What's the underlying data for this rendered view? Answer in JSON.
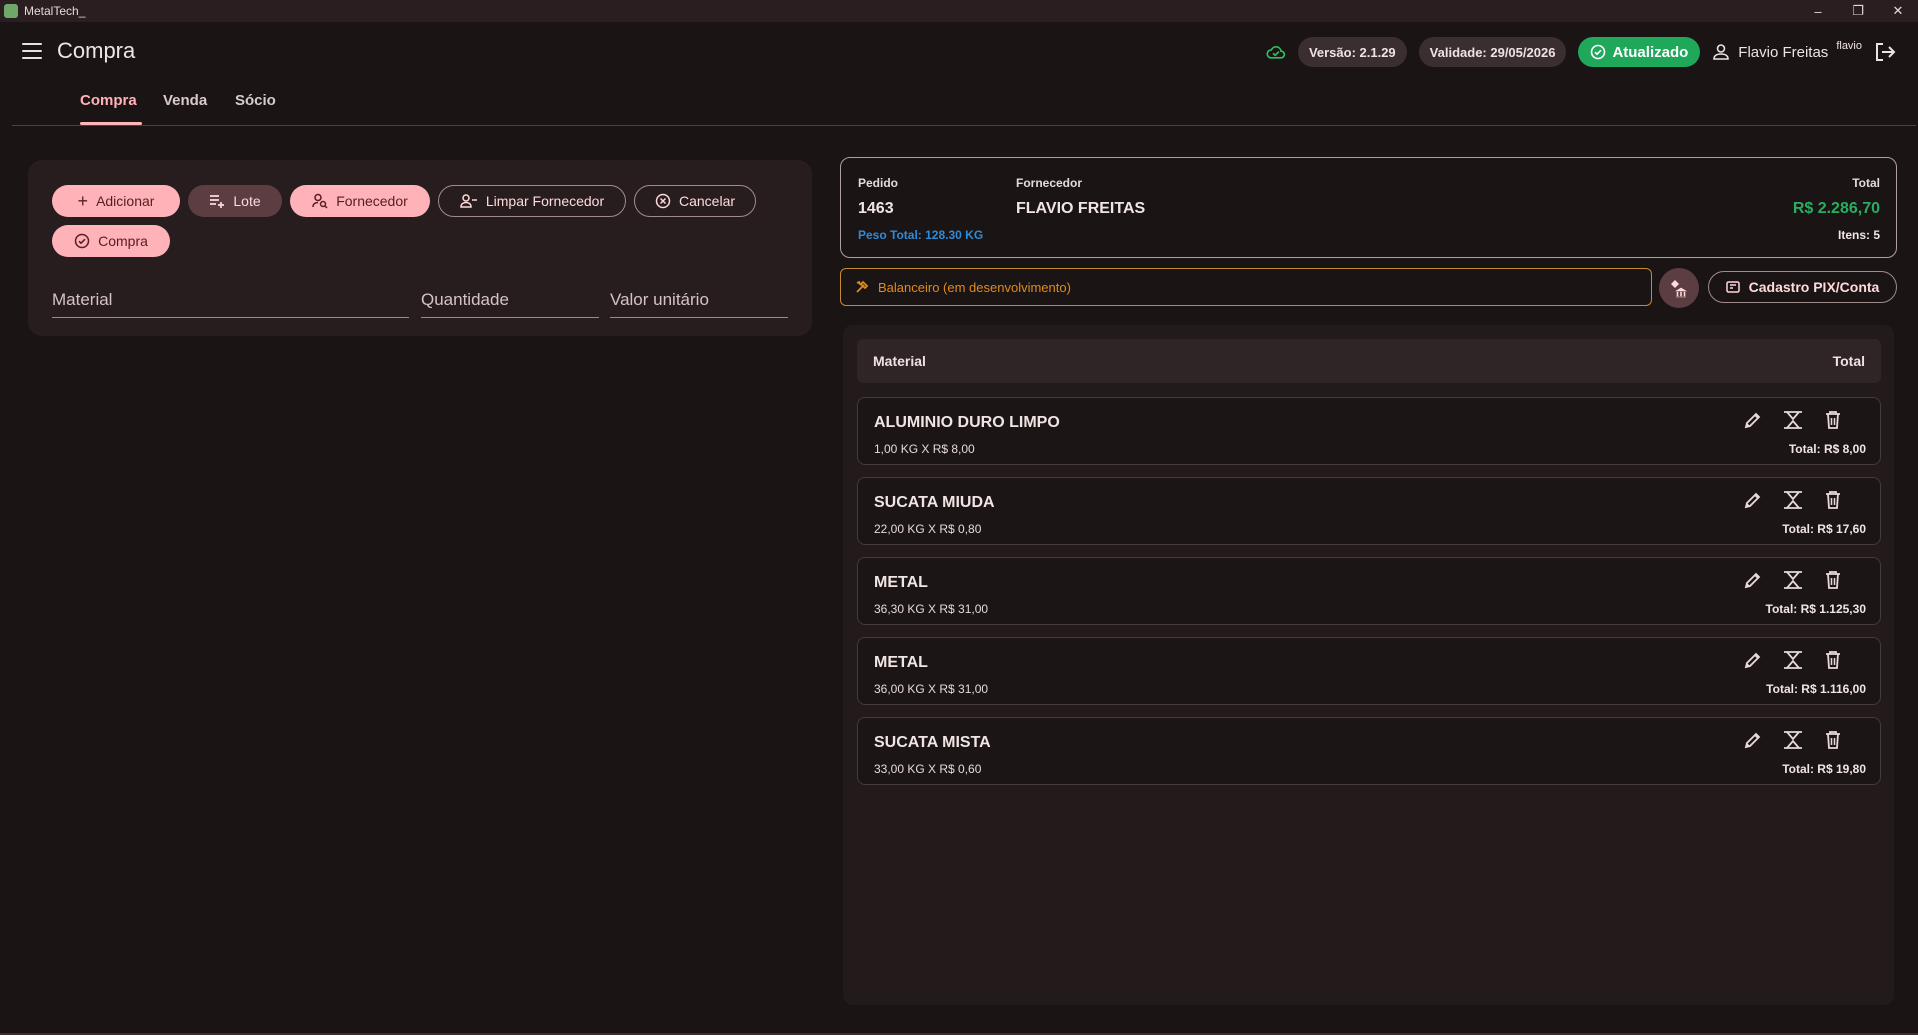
{
  "window": {
    "title": "MetalTech_",
    "controls": [
      "–",
      "❐",
      "✕"
    ]
  },
  "header": {
    "title": "Compra",
    "version": "Versão: 2.1.29",
    "validity": "Validade: 29/05/2026",
    "status": "Atualizado",
    "user_name": "Flavio Freitas",
    "user_login": "flavio",
    "accent": "#ffb3b8",
    "status_color": "#1fa85a"
  },
  "tabs": [
    {
      "label": "Compra",
      "active": true
    },
    {
      "label": "Venda",
      "active": false
    },
    {
      "label": "Sócio",
      "active": false
    }
  ],
  "actions": {
    "adicionar": "Adicionar",
    "lote": "Lote",
    "fornecedor": "Fornecedor",
    "limpar_fornecedor": "Limpar Fornecedor",
    "cancelar": "Cancelar",
    "compra": "Compra"
  },
  "form": {
    "material_label": "Material",
    "quantidade_label": "Quantidade",
    "valor_label": "Valor unitário"
  },
  "order": {
    "pedido_label": "Pedido",
    "pedido": "1463",
    "fornecedor_label": "Fornecedor",
    "fornecedor": "FLAVIO FREITAS",
    "total_label": "Total",
    "total": "R$ 2.286,70",
    "peso": "Peso Total: 128.30 KG",
    "itens": "Itens: 5"
  },
  "balanceiro": "Balanceiro (em desenvolvimento)",
  "pix_button": "Cadastro PIX/Conta",
  "list": {
    "col_material": "Material",
    "col_total": "Total",
    "items": [
      {
        "name": "ALUMINIO DURO LIMPO",
        "qty": "1,00 KG  X  R$ 8,00",
        "total": "Total: R$ 8,00"
      },
      {
        "name": "SUCATA MIUDA",
        "qty": "22,00 KG  X  R$ 0,80",
        "total": "Total: R$ 17,60"
      },
      {
        "name": "METAL",
        "qty": "36,30 KG  X  R$ 31,00",
        "total": "Total: R$ 1.125,30"
      },
      {
        "name": "METAL",
        "qty": "36,00 KG  X  R$ 31,00",
        "total": "Total: R$ 1.116,00"
      },
      {
        "name": "SUCATA MISTA",
        "qty": "33,00 KG  X  R$ 0,60",
        "total": "Total: R$ 19,80"
      }
    ]
  }
}
